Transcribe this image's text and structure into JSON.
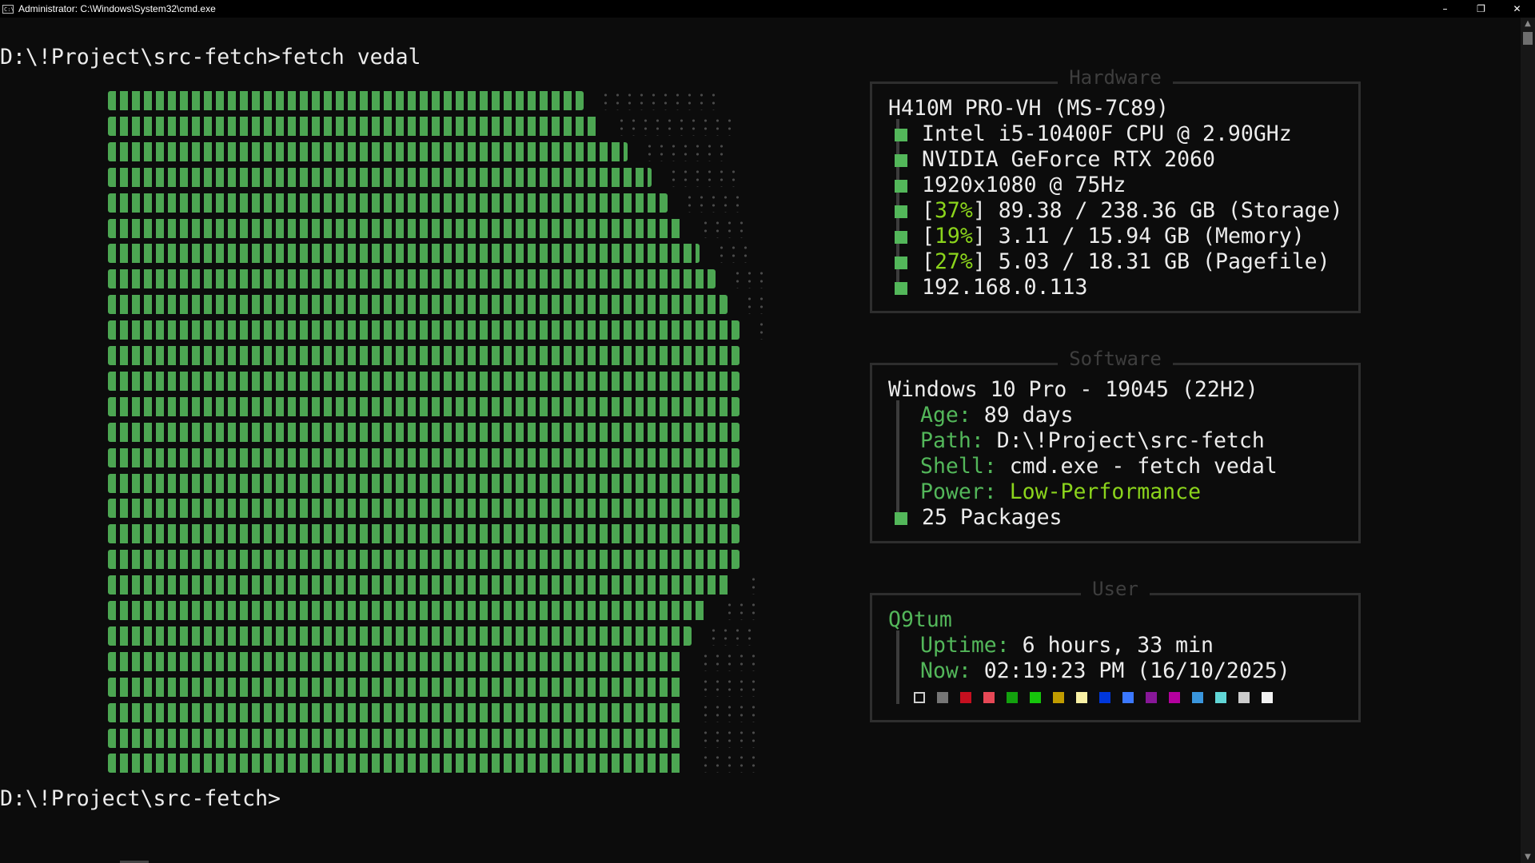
{
  "window": {
    "title": "Administrator: C:\\Windows\\System32\\cmd.exe",
    "icon_label": "C:\\",
    "controls": [
      "–",
      "❐",
      "✕"
    ]
  },
  "terminal": {
    "command_line": "D:\\!Project\\src-fetch>fetch vedal",
    "prompt_line": "D:\\!Project\\src-fetch>",
    "ascii_art_color": "#53b75a"
  },
  "hardware": {
    "title": "Hardware",
    "board": "H410M PRO-VH (MS-7C89)",
    "cpu": "Intel i5-10400F CPU @ 2.90GHz",
    "gpu": "NVIDIA GeForce RTX 2060",
    "display": "1920x1080 @ 75Hz",
    "storage": {
      "percent": "37%",
      "rest": "89.38 / 238.36 GB (Storage)"
    },
    "memory": {
      "percent": "19%",
      "rest": "3.11 / 15.94 GB (Memory)"
    },
    "pagefile": {
      "percent": "27%",
      "rest": "5.03 / 18.31 GB (Pagefile)"
    },
    "ip": "192.168.0.113"
  },
  "software": {
    "title": "Software",
    "os": "Windows 10 Pro - 19045 (22H2)",
    "age_key": "Age:",
    "age_val": "89 days",
    "path_key": "Path:",
    "path_val": "D:\\!Project\\src-fetch",
    "shell_key": "Shell:",
    "shell_val": "cmd.exe - fetch vedal",
    "power_key": "Power:",
    "power_val": "Low-Performance",
    "packages": "25 Packages"
  },
  "user": {
    "title": "User",
    "name": "Q9tum",
    "uptime_key": "Uptime:",
    "uptime_val": "6 hours, 33 min",
    "now_key": "Now:",
    "now_val": "02:19:23 PM (16/10/2025)",
    "palette": [
      "#0c0c0c",
      "#767676",
      "#c50f1f",
      "#e74856",
      "#13a10e",
      "#16c60c",
      "#c19c00",
      "#f9f1a5",
      "#0037da",
      "#3b78ff",
      "#881798",
      "#b4009e",
      "#3a96dd",
      "#61d6d6",
      "#cccccc",
      "#f2f2f2"
    ]
  }
}
